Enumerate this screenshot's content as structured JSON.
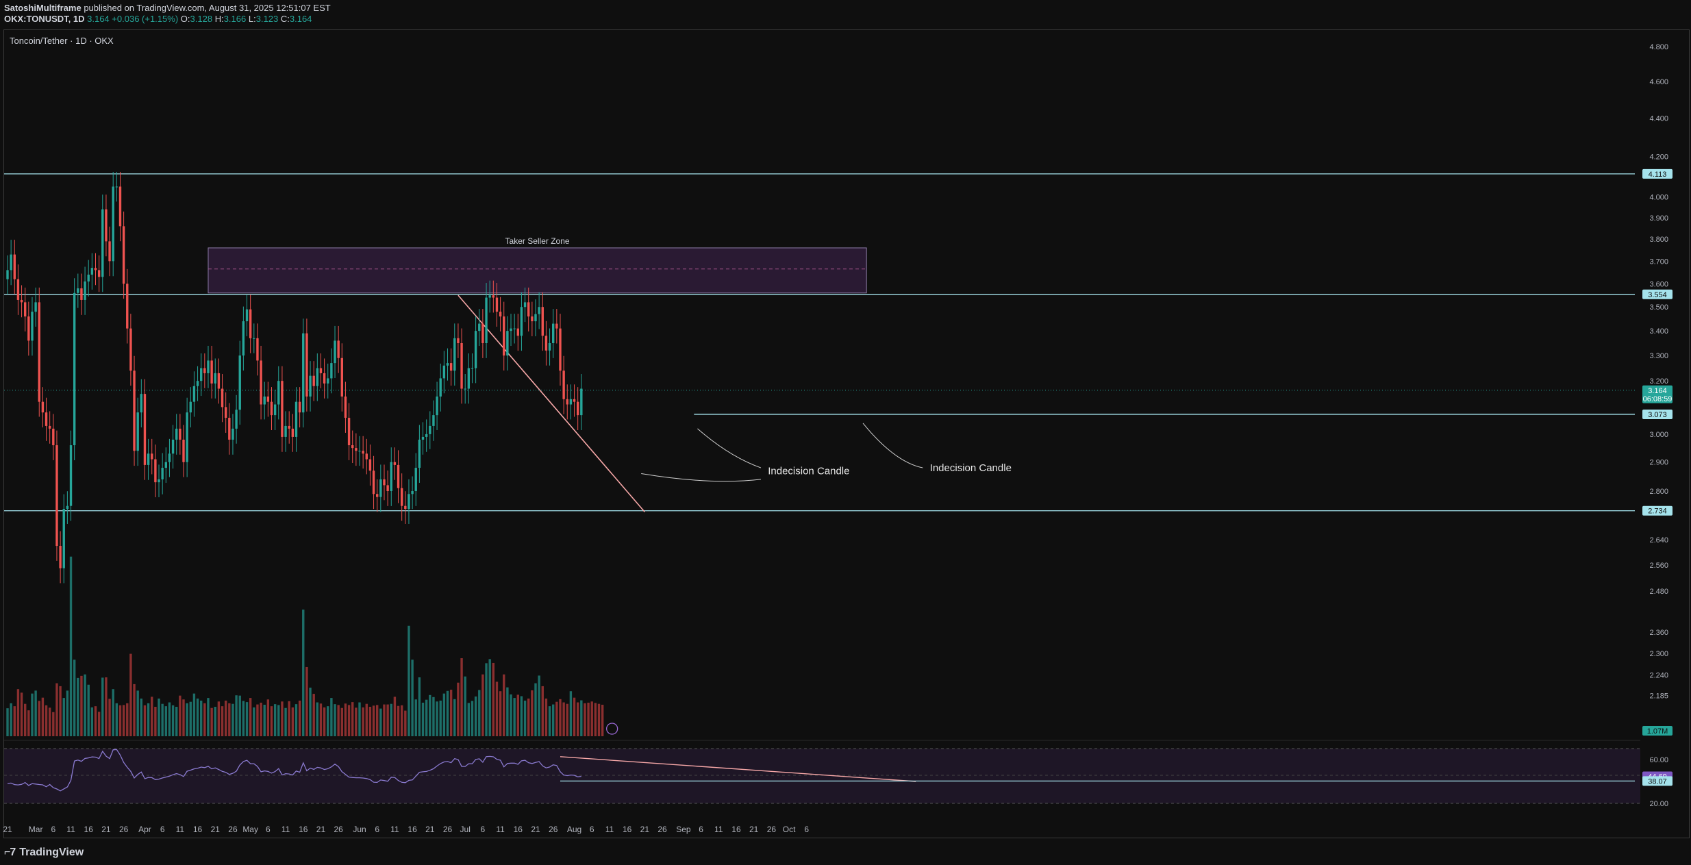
{
  "header": {
    "author": "SatoshiMultiframe",
    "published": "published on TradingView.com, August 31, 2025 12:51:07 EST",
    "symbol": "OKX:TONUSDT, 1D",
    "price": "3.164",
    "change": "+0.036 (+1.15%)",
    "o_label": "O:",
    "o": "3.128",
    "h_label": "H:",
    "h": "3.166",
    "l_label": "L:",
    "l": "3.123",
    "c_label": "C:",
    "c": "3.164"
  },
  "legend": "Toncoin/Tether · 1D · OKX",
  "footer": {
    "brand": "TradingView"
  },
  "colors": {
    "up": "#26a69a",
    "down": "#ef5350",
    "level": "#a5e3ec",
    "zone": "#2a1a33",
    "rsi": "#8a7ad0",
    "trend": "#f7a8a8"
  },
  "chart_data": {
    "type": "candlestick",
    "title": "Toncoin/Tether · 1D · OKX",
    "y_axis": {
      "scale": "log",
      "ylim": [
        2.08,
        4.9
      ],
      "ticks": [
        "4.800",
        "4.600",
        "4.400",
        "4.200",
        "4.000",
        "3.900",
        "3.800",
        "3.700",
        "3.600",
        "3.500",
        "3.400",
        "3.300",
        "3.200",
        "3.000",
        "2.900",
        "2.800",
        "2.640",
        "2.560",
        "2.480",
        "2.360",
        "2.300",
        "2.240",
        "2.185"
      ]
    },
    "x_axis": {
      "ticks": [
        "21",
        "Mar",
        "6",
        "11",
        "16",
        "21",
        "26",
        "Apr",
        "6",
        "11",
        "16",
        "21",
        "26",
        "May",
        "6",
        "11",
        "16",
        "21",
        "26",
        "Jun",
        "6",
        "11",
        "16",
        "21",
        "26",
        "Jul",
        "6",
        "11",
        "16",
        "21",
        "26",
        "Aug",
        "6",
        "11",
        "16",
        "21",
        "26",
        "Sep",
        "6",
        "11",
        "16",
        "21",
        "26",
        "Oct",
        "6"
      ]
    },
    "price_labels": [
      {
        "value": "4.113",
        "kind": "level"
      },
      {
        "value": "3.554",
        "kind": "level"
      },
      {
        "value": "3.164",
        "kind": "last"
      },
      {
        "value": "06:08:59",
        "kind": "countdown"
      },
      {
        "value": "3.073",
        "kind": "level"
      },
      {
        "value": "2.734",
        "kind": "level"
      },
      {
        "value": "1.07M",
        "kind": "volume"
      }
    ],
    "levels": [
      4.113,
      3.554,
      3.073,
      2.734
    ],
    "zone": {
      "label": "Taker Seller Zone",
      "low": 3.56,
      "high": 3.76,
      "mid": 3.665
    },
    "annotations": [
      "Indecision Candle",
      "Indecision Candle"
    ],
    "candles": {
      "start": "2025-02-21",
      "end": "2025-08-31",
      "close": [
        3.66,
        3.73,
        3.62,
        3.53,
        3.52,
        3.46,
        3.36,
        3.48,
        3.52,
        3.12,
        3.08,
        3.03,
        3.02,
        2.96,
        2.62,
        2.55,
        2.74,
        2.75,
        2.96,
        3.56,
        3.58,
        3.53,
        3.61,
        3.64,
        3.67,
        3.66,
        3.63,
        3.94,
        3.79,
        3.7,
        4.05,
        4.05,
        3.86,
        3.6,
        3.41,
        3.24,
        2.94,
        3.08,
        3.15,
        2.89,
        2.93,
        2.91,
        2.83,
        2.84,
        2.88,
        2.9,
        2.93,
        2.98,
        3.02,
        2.98,
        2.9,
        3.08,
        3.12,
        3.18,
        3.2,
        3.25,
        3.23,
        3.28,
        3.19,
        3.23,
        3.17,
        3.1,
        3.06,
        2.98,
        3.02,
        3.09,
        3.3,
        3.44,
        3.49,
        3.37,
        3.37,
        3.28,
        3.11,
        3.14,
        3.12,
        3.07,
        3.11,
        3.2,
        2.99,
        3.03,
        3.02,
        2.99,
        3.12,
        3.08,
        3.39,
        3.14,
        3.22,
        3.18,
        3.25,
        3.23,
        3.19,
        3.21,
        3.27,
        3.36,
        3.29,
        3.14,
        3.06,
        2.96,
        2.95,
        2.94,
        2.94,
        2.93,
        2.91,
        2.87,
        2.79,
        2.78,
        2.84,
        2.82,
        2.8,
        2.9,
        2.89,
        2.81,
        2.75,
        2.74,
        2.79,
        2.8,
        2.88,
        2.98,
        2.99,
        3.0,
        3.03,
        3.07,
        3.14,
        3.21,
        3.26,
        3.27,
        3.24,
        3.37,
        3.35,
        3.17,
        3.17,
        3.25,
        3.25,
        3.4,
        3.43,
        3.35,
        3.54,
        3.55,
        3.54,
        3.48,
        3.46,
        3.3,
        3.4,
        3.41,
        3.41,
        3.38,
        3.5,
        3.52,
        3.46,
        3.44,
        3.47,
        3.5,
        3.38,
        3.32,
        3.35,
        3.43,
        3.41,
        3.24,
        3.13,
        3.11,
        3.13,
        3.12,
        3.07,
        3.17
      ],
      "volume_m": [
        0.95,
        1.12,
        1.02,
        1.6,
        1.48,
        1.1,
        0.88,
        1.45,
        1.55,
        1.2,
        1.31,
        1.05,
        0.97,
        0.82,
        1.8,
        1.7,
        1.3,
        1.55,
        6.1,
        2.6,
        1.98,
        2.05,
        2.1,
        1.75,
        0.98,
        1.02,
        0.83,
        1.99,
        2.0,
        1.27,
        1.6,
        1.12,
        1.05,
        1.06,
        1.12,
        2.8,
        1.77,
        1.55,
        1.28,
        1.05,
        1.12,
        1.34,
        1.0,
        1.28,
        1.1,
        1.02,
        1.15,
        1.05,
        1.0,
        1.38,
        1.25,
        1.12,
        1.17,
        1.45,
        1.28,
        1.21,
        1.12,
        1.3,
        0.96,
        1.0,
        1.18,
        1.02,
        1.21,
        1.12,
        1.1,
        1.39,
        1.38,
        1.2,
        1.16,
        1.3,
        0.98,
        1.08,
        1.14,
        1.07,
        1.25,
        1.02,
        1.09,
        1.06,
        1.18,
        0.96,
        1.19,
        0.98,
        1.09,
        1.21,
        4.3,
        2.35,
        1.65,
        1.44,
        1.15,
        1.11,
        0.98,
        1.02,
        1.3,
        1.09,
        1.06,
        0.96,
        1.11,
        1.06,
        1.16,
        0.97,
        1.15,
        0.98,
        1.1,
        1.0,
        1.04,
        1.06,
        0.94,
        1.08,
        1.08,
        1.1,
        1.34,
        1.03,
        1.05,
        0.87,
        3.75,
        2.6,
        1.25,
        2.0,
        1.14,
        1.24,
        1.4,
        1.33,
        1.18,
        1.21,
        1.45,
        1.54,
        1.58,
        1.26,
        1.82,
        2.65,
        2.03,
        1.13,
        1.2,
        1.35,
        1.57,
        2.1,
        2.48,
        2.62,
        2.49,
        1.85,
        1.53,
        2.1,
        1.66,
        1.42,
        1.3,
        1.41,
        1.36,
        1.21,
        1.28,
        1.56,
        1.8,
        2.06,
        1.7,
        1.28,
        1.02,
        1.08,
        1.17,
        1.26,
        1.15,
        1.1,
        1.53,
        1.31,
        1.15,
        1.22,
        1.12,
        1.14,
        1.18,
        1.13,
        1.1,
        1.07
      ],
      "rsi": [
        38.2,
        38.5,
        37.1,
        36.8,
        37.4,
        39.0,
        36.4,
        38.0,
        37.6,
        37.2,
        36.9,
        35.1,
        37.2,
        34.3,
        33.1,
        31.4,
        33.2,
        35.0,
        41.0,
        58.7,
        59.5,
        58.4,
        61.0,
        61.5,
        62.4,
        62.2,
        60.9,
        67.5,
        63.1,
        60.9,
        68.9,
        69.1,
        64.1,
        57.3,
        52.9,
        49.2,
        43.2,
        46.4,
        48.6,
        42.5,
        43.7,
        43.5,
        41.7,
        42.1,
        43.2,
        44.0,
        44.8,
        46.1,
        47.2,
        46.2,
        44.5,
        49.3,
        50.3,
        51.5,
        52.0,
        53.1,
        52.6,
        53.8,
        51.5,
        52.4,
        50.9,
        49.2,
        48.3,
        46.4,
        47.5,
        49.4,
        55.0,
        58.2,
        59.3,
        56.2,
        56.2,
        53.7,
        48.8,
        49.6,
        49.1,
        47.6,
        49.0,
        51.7,
        45.9,
        47.1,
        46.8,
        45.9,
        49.5,
        48.4,
        57.0,
        49.7,
        52.2,
        51.0,
        52.9,
        52.3,
        50.9,
        51.6,
        53.3,
        55.8,
        53.5,
        48.9,
        46.5,
        43.9,
        43.6,
        43.4,
        43.4,
        43.1,
        42.6,
        41.6,
        39.3,
        39.1,
        41.3,
        40.8,
        40.1,
        43.9,
        43.6,
        40.9,
        39.2,
        38.9,
        41.0,
        41.4,
        44.8,
        48.4,
        48.8,
        49.1,
        50.2,
        51.6,
        54.1,
        56.3,
        57.8,
        58.2,
        57.1,
        60.8,
        60.0,
        53.7,
        53.7,
        56.2,
        56.2,
        60.1,
        60.7,
        57.5,
        62.6,
        62.9,
        62.5,
        60.1,
        59.4,
        53.3,
        56.4,
        56.7,
        56.7,
        55.6,
        58.8,
        59.3,
        57.1,
        56.4,
        57.3,
        58.1,
        54.2,
        52.4,
        53.2,
        55.2,
        54.5,
        48.9,
        45.8,
        45.3,
        45.9,
        45.6,
        44.2,
        44.7
      ],
      "rsi_label": "44.69",
      "rsi_ticks": [
        "60.00",
        "20.00"
      ],
      "rsi_support_label": "38.07"
    }
  }
}
